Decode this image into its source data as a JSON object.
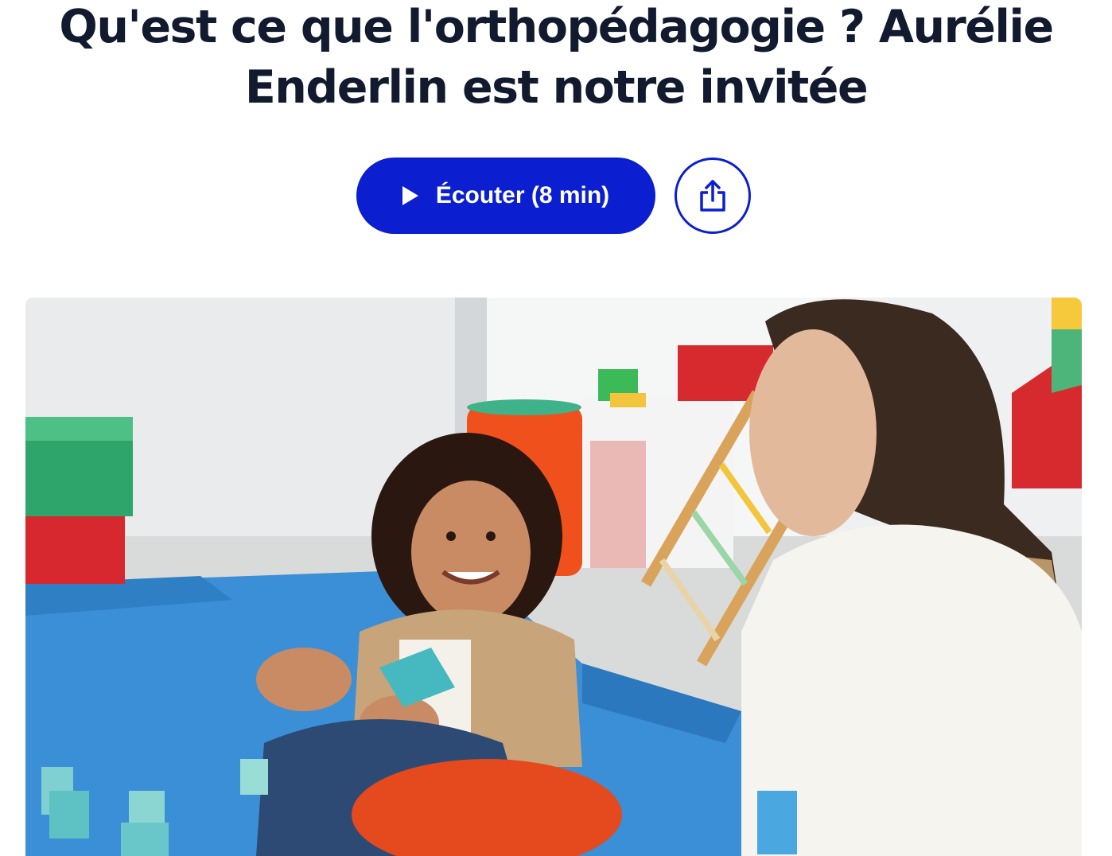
{
  "article": {
    "title_line1": "Qu'est ce que l'orthopédagogie ? Aurélie",
    "title_line2": "Enderlin est notre invitée"
  },
  "actions": {
    "listen_label": "Écouter (8 min)",
    "play_icon": "play-icon",
    "share_icon": "share-icon"
  },
  "colors": {
    "title": "#111a2e",
    "accent": "#0b1ed0",
    "background": "#ffffff"
  },
  "hero": {
    "alt": "child-smiling-with-therapist-photo"
  }
}
